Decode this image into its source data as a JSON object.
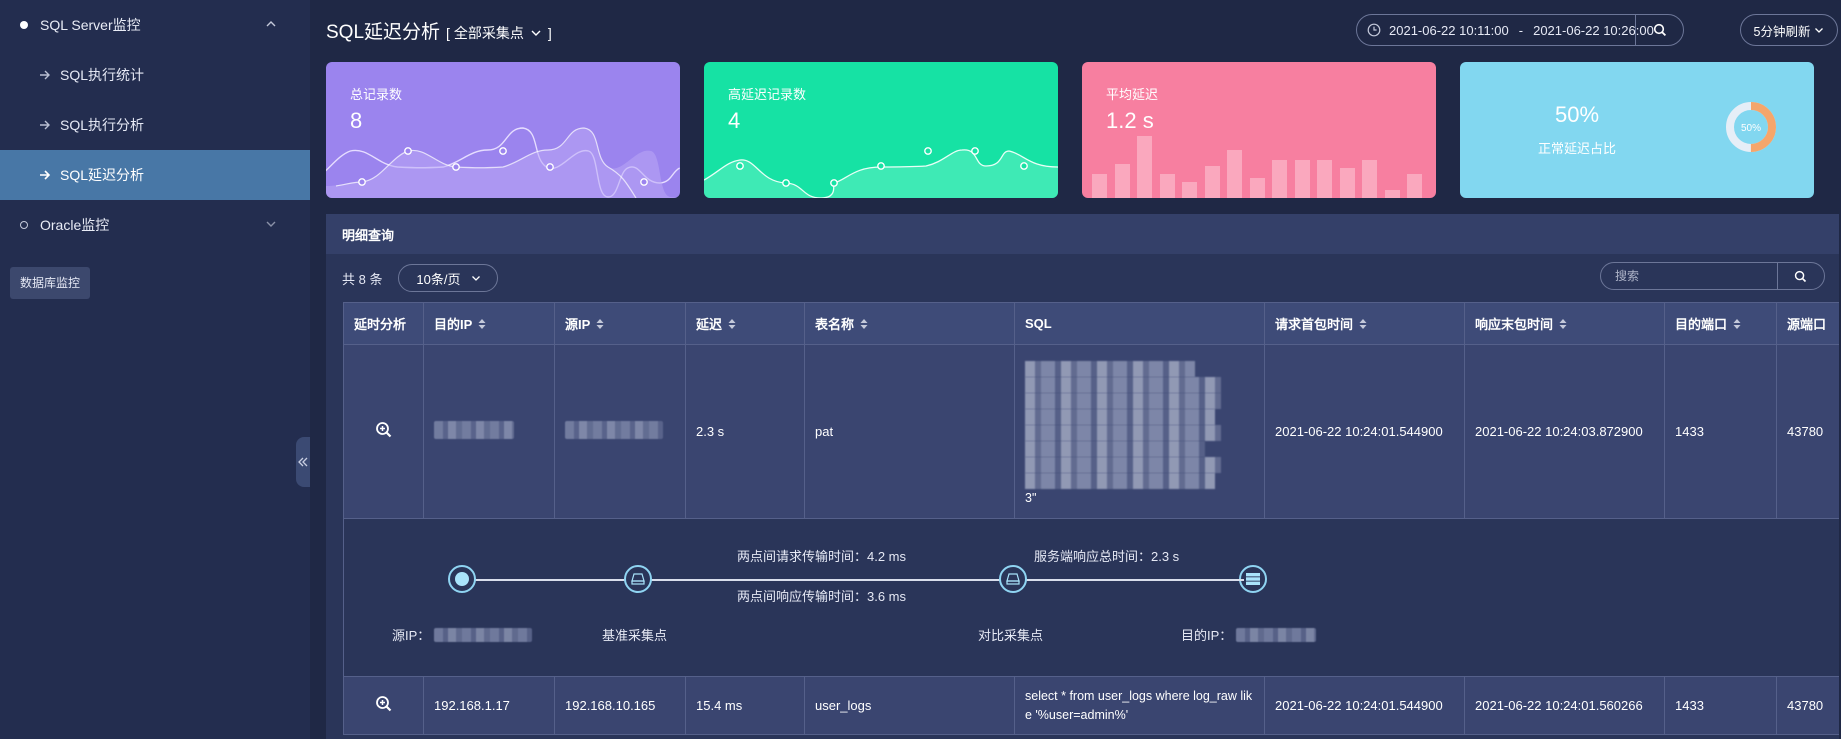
{
  "sidebar": {
    "groups": [
      {
        "label": "SQL Server监控",
        "expanded": true,
        "items": [
          {
            "label": "SQL执行统计"
          },
          {
            "label": "SQL执行分析"
          },
          {
            "label": "SQL延迟分析",
            "active": true
          }
        ]
      },
      {
        "label": "Oracle监控",
        "expanded": false
      }
    ],
    "db_monitor_button": "数据库监控"
  },
  "header": {
    "title": "SQL延迟分析",
    "scope_open": "[",
    "scope_label": "全部采集点",
    "scope_close": "]",
    "date_start": "2021-06-22 10:11:00",
    "date_separator": "-",
    "date_end": "2021-06-22 10:26:00",
    "refresh_label": "5分钟刷新"
  },
  "cards": {
    "total": {
      "label": "总记录数",
      "value": "8",
      "color": "#9b84ee"
    },
    "high": {
      "label": "高延迟记录数",
      "value": "4",
      "color": "#16e2a4"
    },
    "avg": {
      "label": "平均延迟",
      "value": "1.2 s",
      "color": "#f77fa0"
    },
    "ratio": {
      "percent": "50%",
      "label": "正常延迟占比",
      "donut_label": "50%",
      "fraction": 0.5,
      "color": "#82d7f0",
      "accent": "#f5a66b"
    }
  },
  "detail": {
    "title": "明细查询",
    "total_text": "共 8 条",
    "page_size": "10条/页",
    "search_placeholder": "搜索",
    "columns": [
      "延时分析",
      "目的IP",
      "源IP",
      "延迟",
      "表名称",
      "SQL",
      "请求首包时间",
      "响应末包时间",
      "目的端口",
      "源端口"
    ],
    "rows": [
      {
        "dst_ip": "",
        "src_ip": "",
        "latency": "2.3 s",
        "table": "pat",
        "sql_tail": "3\"",
        "req_time": "2021-06-22 10:24:01.544900",
        "resp_time": "2021-06-22 10:24:03.872900",
        "dst_port": "1433",
        "src_port": "43780"
      },
      {
        "dst_ip": "192.168.1.17",
        "src_ip": "192.168.10.165",
        "latency": "15.4 ms",
        "table": "user_logs",
        "sql": "select * from user_logs where log_raw like '%user=admin%'",
        "req_time": "2021-06-22 10:24:01.544900",
        "resp_time": "2021-06-22 10:24:01.560266",
        "dst_port": "1433",
        "src_port": "43780"
      }
    ],
    "flow": {
      "req_transfer": "两点间请求传输时间：4.2 ms",
      "resp_transfer": "两点间响应传输时间：3.6 ms",
      "server_total": "服务端响应总时间：2.3 s",
      "src_label": "源IP：",
      "base_point": "基准采集点",
      "compare_point": "对比采集点",
      "dst_label": "目的IP："
    }
  }
}
